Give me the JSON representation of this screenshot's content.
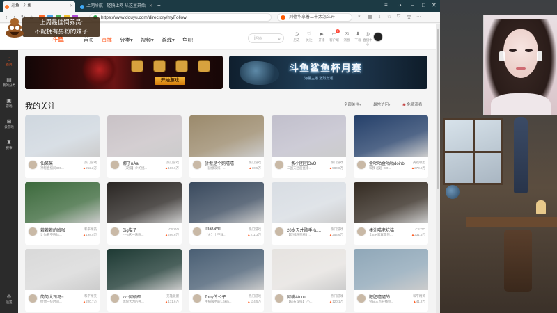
{
  "browser": {
    "tabs": [
      {
        "label": "斗鱼 - 斗鱼",
        "active": true
      },
      {
        "label": "上网导航 - 轻快上网 从这里开始",
        "active": false
      }
    ],
    "url": "https://www.douyu.com/directory/myFollow",
    "search_text": "刘德华拿着二十太怎么开"
  },
  "site": {
    "logo": "斗鱼",
    "nav": [
      "首页",
      "直播",
      "分类",
      "视频",
      "游戏",
      "鱼吧"
    ],
    "search_placeholder": "jjsyy",
    "header_icons": [
      {
        "name": "history-icon",
        "label": "历史"
      },
      {
        "name": "follow-icon",
        "label": "关注"
      },
      {
        "name": "live-icon",
        "label": "开播"
      },
      {
        "name": "creator-icon",
        "label": "客户端",
        "badge": "1"
      },
      {
        "name": "message-icon",
        "label": "消息"
      },
      {
        "name": "app-icon",
        "label": "下载"
      },
      {
        "name": "center-icon",
        "label": "直播中心"
      }
    ]
  },
  "leftbar": [
    {
      "glyph": "⌂",
      "label": "首页",
      "active": true
    },
    {
      "glyph": "▤",
      "label": "我的分类",
      "active": false
    },
    {
      "glyph": "▣",
      "label": "游戏",
      "active": false
    },
    {
      "glyph": "⊞",
      "label": "云游戏",
      "active": false
    },
    {
      "glyph": "♜",
      "label": "赛事",
      "active": false
    },
    {
      "glyph": "⚙",
      "label": "设置",
      "active": false
    }
  ],
  "banners": {
    "left_button": "开始游戏",
    "right_title": "斗鱼鲨鱼杯月赛",
    "right_sub": "海量主播 激烈角逐"
  },
  "section": {
    "title": "我的关注",
    "filters": [
      {
        "label": "全部关注",
        "chev": "▾"
      },
      {
        "label": "最常访问",
        "chev": "▾"
      },
      {
        "label": "免费观看",
        "chev": ""
      }
    ]
  },
  "cards": [
    {
      "name": "仙某某",
      "cat": "热门游戏",
      "title": "神秘直播间800...",
      "hot": "252.2万",
      "thumb": "#cfd7df"
    },
    {
      "name": "娜子nAa",
      "cat": "热门游戏",
      "title": "【双排】少的挑...",
      "hot": "166.6万",
      "thumb": "#c9c2c6"
    },
    {
      "name": "骄傲是个鹅嘻嘻",
      "cat": "热门游戏",
      "title": "【骄傲双排】...",
      "hot": "10.5万",
      "thumb": "#9b8a6c"
    },
    {
      "name": "一条小团团OvO",
      "cat": "热门游戏",
      "title": "三国天团后直播...",
      "hot": "580.8万",
      "thumb": "#c1bfcc"
    },
    {
      "name": "金咕咕金咕咕doinb",
      "cat": "英雄联盟",
      "title": "和我 超越 GO...",
      "hot": "370.8万",
      "thumb": "#25406a"
    },
    {
      "name": "若若若的脸咖",
      "cat": "和平精英",
      "title": "让你看不透哈...",
      "hot": "198.5万",
      "thumb": "#3d6a3d"
    },
    {
      "name": "Big猫子",
      "cat": "CS:GO",
      "title": "FPS这一块啊...",
      "hot": "296.6万",
      "thumb": "#2a2623"
    },
    {
      "name": "imaxavin",
      "cat": "热门游戏",
      "title": "【火】上不就...",
      "hot": "211.3万",
      "thumb": "#3a4a5e"
    },
    {
      "name": "20岁天才歌手Ku...",
      "cat": "热门游戏",
      "title": "【双排胜率榜】...",
      "hot": "254.6万",
      "thumb": "#d8dde3"
    },
    {
      "name": "棒汁喵老坑猫",
      "cat": "CS:GO",
      "title": "全SIR家就是我...",
      "hot": "231.6万",
      "thumb": "#342b22"
    },
    {
      "name": "简简大司马~",
      "cat": "和平精英",
      "title": "给你一些时间...",
      "hot": "220.7万",
      "thumb": "#d9d9d9"
    },
    {
      "name": "zzc阿硕硕",
      "cat": "英雄联盟",
      "title": "无限大力的神...",
      "hot": "171.6万",
      "thumb": "#1e3a34"
    },
    {
      "name": "Tony传公子",
      "cat": "热门游戏",
      "title": "主播服务的1.6km...",
      "hot": "114.5万",
      "thumb": "#4a5f74"
    },
    {
      "name": "阿楠Afuuu",
      "cat": "热门游戏",
      "title": "【钻石双排】 小...",
      "hot": "120.1万",
      "thumb": "#e6e3e0"
    },
    {
      "name": "肥肥嘘嘘的",
      "cat": "和平精英",
      "title": "今日三点开播别...",
      "hot": "41.2万",
      "thumb": "#8fa7b8"
    }
  ],
  "overlay": {
    "line1": "上周最佳饲养员:",
    "line2": "不配拥有男粉的妹子"
  }
}
